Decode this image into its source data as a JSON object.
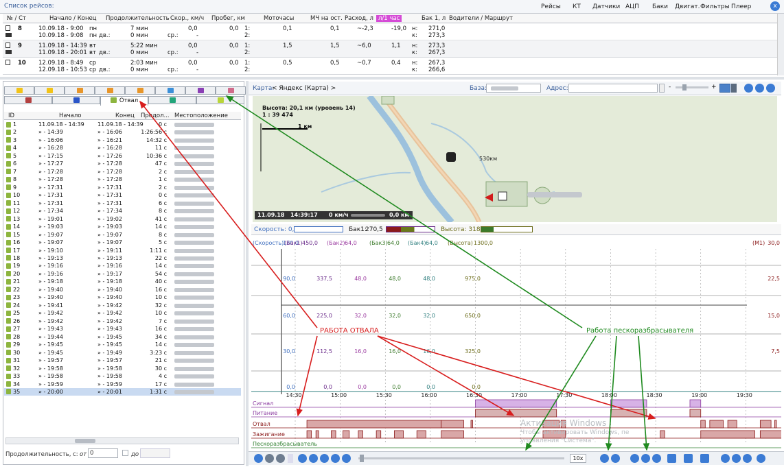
{
  "trips": {
    "title": "Список рейсов:",
    "menu": [
      "Рейсы",
      "КТ",
      "Датчики",
      "АЦП",
      "Баки",
      "Двигат.",
      "Фильтры",
      "Плеер"
    ],
    "close_label": "x",
    "columns": [
      "№ / Ст",
      "Начало / Конец",
      "Продолжительность",
      "Скор., км/ч",
      "Пробег, км",
      "Моточасы",
      "МЧ на ост.",
      "Расход, л",
      "л/1 час",
      "Бак 1, л",
      "Водители / Маршрут"
    ],
    "rows": [
      {
        "num": "8",
        "start": "10.09.18 - 9:00",
        "start_dow": "пн",
        "end": "10.09.18 - 9:08",
        "end_dow": "пн",
        "dur1": "7 мин",
        "dur2": "0 мин",
        "dur2_label": "дв.:",
        "speed": "0,0",
        "speed_label": "ср.:",
        "speed2": "-",
        "dist": "0,0",
        "m1_label": "1:",
        "m2_label": "2:",
        "moto": "0,1",
        "mch": "0,1",
        "rash": "~-2,3",
        "lh": "-19,0",
        "bak_label1": "н:",
        "bak_label2": "к:",
        "bak1": "271,0",
        "bak2": "273,3"
      },
      {
        "num": "9",
        "start": "11.09.18 - 14:39",
        "start_dow": "вт",
        "end": "11.09.18 - 20:01",
        "end_dow": "вт",
        "dur1": "5:22 мин",
        "dur2": "0 мин",
        "dur2_label": "дв.:",
        "speed": "0,0",
        "speed_label": "ср.:",
        "speed2": "-",
        "dist": "0,0",
        "m1_label": "1:",
        "m2_label": "2:",
        "moto": "1,5",
        "mch": "1,5",
        "rash": "~6,0",
        "lh": "1,1",
        "bak_label1": "н:",
        "bak_label2": "к:",
        "bak1": "273,3",
        "bak2": "267,3"
      },
      {
        "num": "10",
        "start": "12.09.18 - 8:49",
        "start_dow": "ср",
        "end": "12.09.18 - 10:53",
        "end_dow": "ср",
        "dur1": "2:03 мин",
        "dur2": "0 мин",
        "dur2_label": "дв.:",
        "speed": "0,0",
        "speed_label": "ср.:",
        "speed2": "-",
        "dist": "0,0",
        "m1_label": "1:",
        "m2_label": "2:",
        "moto": "0,5",
        "mch": "0,5",
        "rash": "~0,7",
        "lh": "0,4",
        "bak_label1": "н:",
        "bak_label2": "к:",
        "bak1": "267,3",
        "bak2": "266,6"
      }
    ]
  },
  "left": {
    "active_tab": "Отвал",
    "list_columns": [
      "ID",
      "Начало",
      "Конец",
      "Продол...",
      "Местоположение"
    ],
    "rows": [
      {
        "id": "1",
        "start": "11.09.18 - 14:39",
        "end": "11.09.18 - 14:39",
        "dur": "0 с"
      },
      {
        "id": "2",
        "start": "» - 14:39",
        "end": "» - 16:06",
        "dur": "1:26:56 с"
      },
      {
        "id": "3",
        "start": "» - 16:06",
        "end": "» - 16:21",
        "dur": "14:32 с"
      },
      {
        "id": "4",
        "start": "» - 16:28",
        "end": "» - 16:28",
        "dur": "11 с"
      },
      {
        "id": "5",
        "start": "» - 17:15",
        "end": "» - 17:26",
        "dur": "10:36 с"
      },
      {
        "id": "6",
        "start": "» - 17:27",
        "end": "» - 17:28",
        "dur": "47 с"
      },
      {
        "id": "7",
        "start": "» - 17:28",
        "end": "» - 17:28",
        "dur": "2 с"
      },
      {
        "id": "8",
        "start": "» - 17:28",
        "end": "» - 17:28",
        "dur": "1 с"
      },
      {
        "id": "9",
        "start": "» - 17:31",
        "end": "» - 17:31",
        "dur": "2 с"
      },
      {
        "id": "10",
        "start": "» - 17:31",
        "end": "» - 17:31",
        "dur": "0 с"
      },
      {
        "id": "11",
        "start": "» - 17:31",
        "end": "» - 17:31",
        "dur": "6 с"
      },
      {
        "id": "12",
        "start": "» - 17:34",
        "end": "» - 17:34",
        "dur": "8 с"
      },
      {
        "id": "13",
        "start": "» - 19:01",
        "end": "» - 19:02",
        "dur": "41 с"
      },
      {
        "id": "14",
        "start": "» - 19:03",
        "end": "» - 19:03",
        "dur": "14 с"
      },
      {
        "id": "15",
        "start": "» - 19:07",
        "end": "» - 19:07",
        "dur": "8 с"
      },
      {
        "id": "16",
        "start": "» - 19:07",
        "end": "» - 19:07",
        "dur": "5 с"
      },
      {
        "id": "17",
        "start": "» - 19:10",
        "end": "» - 19:11",
        "dur": "1:11 с"
      },
      {
        "id": "18",
        "start": "» - 19:13",
        "end": "» - 19:13",
        "dur": "22 с"
      },
      {
        "id": "19",
        "start": "» - 19:16",
        "end": "» - 19:16",
        "dur": "14 с"
      },
      {
        "id": "20",
        "start": "» - 19:16",
        "end": "» - 19:17",
        "dur": "54 с"
      },
      {
        "id": "21",
        "start": "» - 19:18",
        "end": "» - 19:18",
        "dur": "40 с"
      },
      {
        "id": "22",
        "start": "» - 19:40",
        "end": "» - 19:40",
        "dur": "16 с"
      },
      {
        "id": "23",
        "start": "» - 19:40",
        "end": "» - 19:40",
        "dur": "10 с"
      },
      {
        "id": "24",
        "start": "» - 19:41",
        "end": "» - 19:42",
        "dur": "32 с"
      },
      {
        "id": "25",
        "start": "» - 19:42",
        "end": "» - 19:42",
        "dur": "10 с"
      },
      {
        "id": "26",
        "start": "» - 19:42",
        "end": "» - 19:42",
        "dur": "7 с"
      },
      {
        "id": "27",
        "start": "» - 19:43",
        "end": "» - 19:43",
        "dur": "16 с"
      },
      {
        "id": "28",
        "start": "» - 19:44",
        "end": "» - 19:45",
        "dur": "34 с"
      },
      {
        "id": "29",
        "start": "» - 19:45",
        "end": "» - 19:45",
        "dur": "14 с"
      },
      {
        "id": "30",
        "start": "» - 19:45",
        "end": "» - 19:49",
        "dur": "3:23 с"
      },
      {
        "id": "31",
        "start": "» - 19:57",
        "end": "» - 19:57",
        "dur": "21 с"
      },
      {
        "id": "32",
        "start": "» - 19:58",
        "end": "» - 19:58",
        "dur": "30 с"
      },
      {
        "id": "33",
        "start": "» - 19:58",
        "end": "» - 19:58",
        "dur": "4 с"
      },
      {
        "id": "34",
        "start": "» - 19:59",
        "end": "» - 19:59",
        "dur": "17 с"
      },
      {
        "id": "35",
        "start": "» - 20:00",
        "end": "» - 20:01",
        "dur": "1:31 с"
      }
    ],
    "duration_label": "Продолжительность, с:",
    "from_label": "от",
    "from_value": "0",
    "to_label": "до"
  },
  "map": {
    "label": "Карта:",
    "source": "< Яндекс (Карта) >",
    "base_label": "База:",
    "address_label": "Адрес:",
    "zoom_minus": "-",
    "zoom_plus": "+",
    "height_text": "Высота: 20,1 км (уровень 14)",
    "scale_text": "1 : 39 474",
    "scale_bar": "1 км",
    "road_km": "530км",
    "status_date": "11.09.18",
    "status_time": "14:39:17",
    "status_speed": "0 км/ч",
    "status_val": "0,0 км"
  },
  "gauges": {
    "speed_label": "Скорость: 0,0",
    "bak_label": "Бак1:",
    "bak_value": "270,5",
    "height_label": "Высота: 318,4"
  },
  "chart_data": {
    "type": "line",
    "legend_left": [
      {
        "name": "(Скорость)",
        "value": "120,0",
        "color": "#3f6fbf"
      },
      {
        "name": "(Бак1)",
        "value": "450,0",
        "color": "#6a2a8a"
      },
      {
        "name": "(Бак2)",
        "value": "64,0",
        "color": "#9b3ba0"
      },
      {
        "name": "(Бак3)",
        "value": "64,0",
        "color": "#3b7a2a"
      },
      {
        "name": "(Бак4)",
        "value": "64,0",
        "color": "#2f7f7f"
      },
      {
        "name": "(Высота)",
        "value": "1300,0",
        "color": "#6b6b18"
      }
    ],
    "legend_right": {
      "name": "(М1)",
      "value": "30,0",
      "color": "#8b1a1a"
    },
    "axis_rows": [
      {
        "speed": "90,0",
        "bak1": "337,5",
        "bak2": "48,0",
        "bak3": "48,0",
        "bak4": "48,0",
        "height": "975,0",
        "m1": "22,5"
      },
      {
        "speed": "60,0",
        "bak1": "225,0",
        "bak2": "32,0",
        "bak3": "32,0",
        "bak4": "32,0",
        "height": "650,0",
        "m1": "15,0"
      },
      {
        "speed": "30,0",
        "bak1": "112,5",
        "bak2": "16,0",
        "bak3": "16,0",
        "bak4": "16,0",
        "height": "325,0",
        "m1": "7,5"
      },
      {
        "speed": "0,0",
        "bak1": "0,0",
        "bak2": "0,0",
        "bak3": "0,0",
        "bak4": "0,0",
        "height": "0,0",
        "m1": ""
      }
    ],
    "x_ticks": [
      "14:30",
      "15:00",
      "15:30",
      "16:00",
      "16:30",
      "17:00",
      "17:30",
      "18:00",
      "18:30",
      "19:00",
      "19:30",
      "20:00"
    ],
    "track_labels": [
      "Сигнал",
      "Питание",
      "Отвал",
      "Зажигание",
      "Пескоразбрасыватель"
    ],
    "signal_segments": [
      [
        16.5,
        17.4
      ],
      [
        18.0,
        18.4
      ],
      [
        18.88,
        19.0
      ]
    ],
    "power_segments": [
      [
        16.5,
        17.4
      ],
      [
        18.0,
        18.4
      ],
      [
        18.88,
        19.0
      ]
    ],
    "otval_segments": [
      [
        14.63,
        16.12
      ],
      [
        16.12,
        16.37
      ],
      [
        16.45,
        16.47
      ],
      [
        17.25,
        17.43
      ],
      [
        17.45,
        17.5
      ],
      [
        19.0,
        19.05
      ],
      [
        19.1,
        19.25
      ],
      [
        19.3,
        19.4
      ],
      [
        19.66,
        19.78
      ],
      [
        19.82,
        19.84
      ],
      [
        19.95,
        20.02
      ]
    ],
    "ignition_segments": [
      [
        14.63,
        14.68
      ],
      [
        14.73,
        14.76
      ],
      [
        14.9,
        14.95
      ],
      [
        15.03,
        15.1
      ],
      [
        15.2,
        15.25
      ],
      [
        15.4,
        15.45
      ],
      [
        15.6,
        15.7
      ],
      [
        15.85,
        15.95
      ],
      [
        16.12,
        16.37
      ],
      [
        17.25,
        17.5
      ],
      [
        18.55,
        18.6
      ],
      [
        19.0,
        19.6
      ],
      [
        19.66,
        19.9
      ]
    ],
    "annotations": [
      "РАБОТА ОТВАЛА",
      "Работа пескоразбрасывателя"
    ],
    "watermark_line1": "Активация Windows",
    "watermark_line2": "Чтобы активировать Windows, пе",
    "watermark_line3": "управления \"Система\"."
  },
  "player": {
    "speed_value": "10x"
  }
}
